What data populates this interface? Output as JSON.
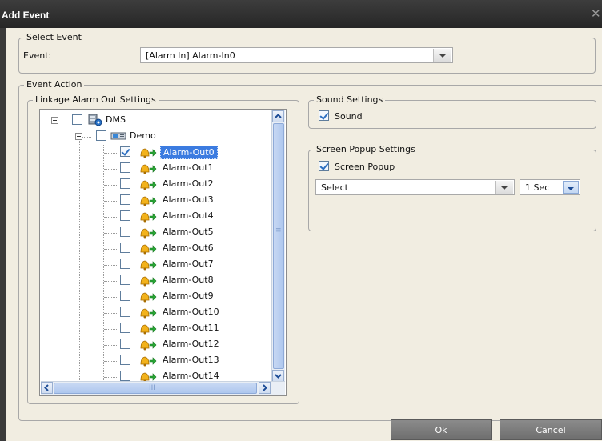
{
  "window": {
    "title": "Add Event"
  },
  "select_event": {
    "legend": "Select Event",
    "event_label": "Event:",
    "event_value": "[Alarm In] Alarm-In0"
  },
  "event_action": {
    "legend": "Event Action"
  },
  "linkage": {
    "legend": "Linkage Alarm Out Settings",
    "root": {
      "label": "DMS",
      "checked": false
    },
    "group": {
      "label": "Demo",
      "checked": false
    },
    "items": [
      {
        "label": "Alarm-Out0",
        "checked": true,
        "selected": true
      },
      {
        "label": "Alarm-Out1",
        "checked": false
      },
      {
        "label": "Alarm-Out2",
        "checked": false
      },
      {
        "label": "Alarm-Out3",
        "checked": false
      },
      {
        "label": "Alarm-Out4",
        "checked": false
      },
      {
        "label": "Alarm-Out5",
        "checked": false
      },
      {
        "label": "Alarm-Out6",
        "checked": false
      },
      {
        "label": "Alarm-Out7",
        "checked": false
      },
      {
        "label": "Alarm-Out8",
        "checked": false
      },
      {
        "label": "Alarm-Out9",
        "checked": false
      },
      {
        "label": "Alarm-Out10",
        "checked": false
      },
      {
        "label": "Alarm-Out11",
        "checked": false
      },
      {
        "label": "Alarm-Out12",
        "checked": false
      },
      {
        "label": "Alarm-Out13",
        "checked": false
      },
      {
        "label": "Alarm-Out14",
        "checked": false
      }
    ],
    "hscroll_thumb_text": "III",
    "vscroll_grip_text": "≡"
  },
  "sound": {
    "legend": "Sound Settings",
    "checkbox_label": "Sound",
    "checked": true
  },
  "popup": {
    "legend": "Screen Popup Settings",
    "checkbox_label": "Screen Popup",
    "checked": true,
    "select_value": "Select",
    "duration_value": "1 Sec"
  },
  "buttons": {
    "ok": "Ok",
    "cancel": "Cancel"
  },
  "colors": {
    "titlebar": "#2f2f2f",
    "body": "#f1ede1",
    "selection": "#3b7be0",
    "button": "#7a7a7a"
  }
}
